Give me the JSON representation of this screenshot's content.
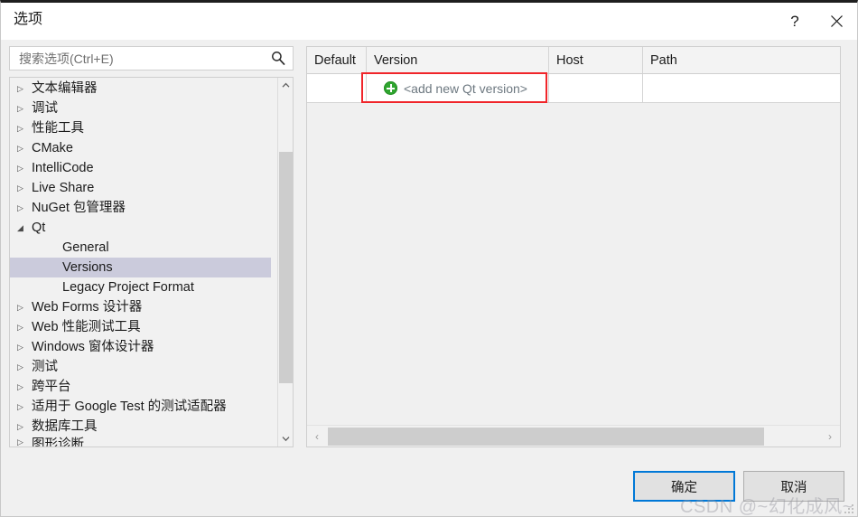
{
  "window": {
    "title": "选项",
    "help_icon": "?",
    "close_icon": "close-icon"
  },
  "search": {
    "placeholder": "搜索选项(Ctrl+E)",
    "value": "",
    "icon": "search-icon"
  },
  "tree": {
    "items": [
      {
        "label": "文本编辑器",
        "level": 0,
        "expanded": false,
        "selected": false
      },
      {
        "label": "调试",
        "level": 0,
        "expanded": false,
        "selected": false
      },
      {
        "label": "性能工具",
        "level": 0,
        "expanded": false,
        "selected": false
      },
      {
        "label": "CMake",
        "level": 0,
        "expanded": false,
        "selected": false
      },
      {
        "label": "IntelliCode",
        "level": 0,
        "expanded": false,
        "selected": false
      },
      {
        "label": "Live Share",
        "level": 0,
        "expanded": false,
        "selected": false
      },
      {
        "label": "NuGet 包管理器",
        "level": 0,
        "expanded": false,
        "selected": false
      },
      {
        "label": "Qt",
        "level": 0,
        "expanded": true,
        "selected": false
      },
      {
        "label": "General",
        "level": 1,
        "expanded": false,
        "selected": false
      },
      {
        "label": "Versions",
        "level": 1,
        "expanded": false,
        "selected": true
      },
      {
        "label": "Legacy Project Format",
        "level": 1,
        "expanded": false,
        "selected": false
      },
      {
        "label": "Web Forms 设计器",
        "level": 0,
        "expanded": false,
        "selected": false
      },
      {
        "label": "Web 性能测试工具",
        "level": 0,
        "expanded": false,
        "selected": false
      },
      {
        "label": "Windows 窗体设计器",
        "level": 0,
        "expanded": false,
        "selected": false
      },
      {
        "label": "测试",
        "level": 0,
        "expanded": false,
        "selected": false
      },
      {
        "label": "跨平台",
        "level": 0,
        "expanded": false,
        "selected": false
      },
      {
        "label": "适用于 Google Test 的测试适配器",
        "level": 0,
        "expanded": false,
        "selected": false
      },
      {
        "label": "数据库工具",
        "level": 0,
        "expanded": false,
        "selected": false
      },
      {
        "label": "图形诊断",
        "level": 0,
        "expanded": false,
        "selected": false,
        "clipped": true
      }
    ],
    "collapsed_arrow": "▷",
    "expanded_arrow": "◢",
    "scrollbar": {
      "up_arrow": "⌃",
      "down_arrow": "⌄"
    }
  },
  "table": {
    "columns": [
      "Default",
      "Version",
      "Host",
      "Path"
    ],
    "rows": [
      {
        "default": "",
        "version": "<add new Qt version>",
        "host": "",
        "path": "",
        "icon": "green-plus-icon"
      }
    ],
    "scrollbar": {
      "left_arrow": "‹",
      "right_arrow": "›"
    }
  },
  "footer": {
    "ok_label": "确定",
    "cancel_label": "取消"
  },
  "watermark": {
    "text": "CSDN @~幻化成风~"
  },
  "colors": {
    "accent": "#0078d7",
    "selection": "#cbcbdc",
    "highlight_box": "#f0252a",
    "plus_green": "#2fa52f",
    "panel_bg": "#f0f0f0"
  }
}
